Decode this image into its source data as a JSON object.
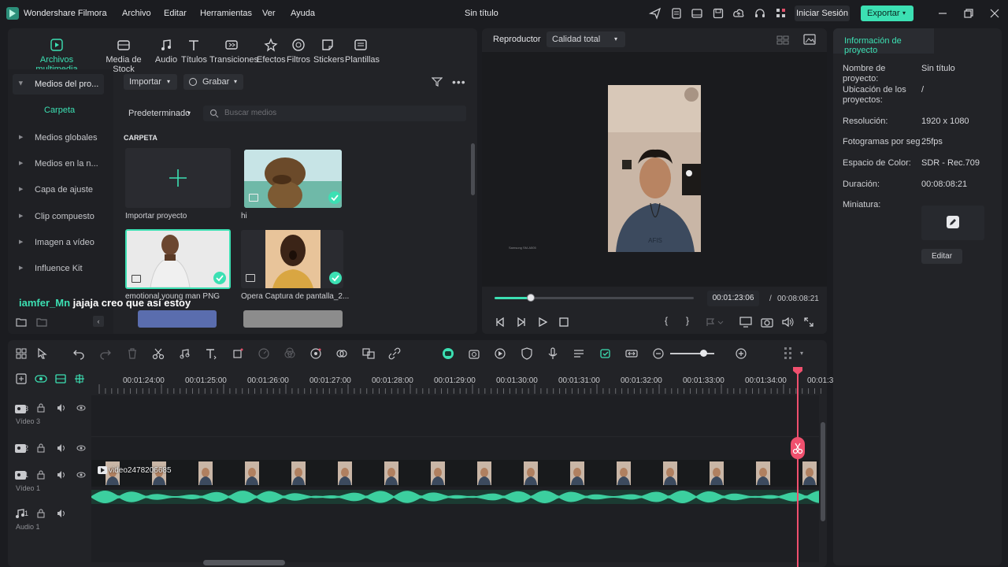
{
  "app": {
    "title": "Wondershare Filmora",
    "document_title": "Sin título",
    "menu": [
      "Archivo",
      "Editar",
      "Herramientas",
      "Ver",
      "Ayuda"
    ],
    "login_label": "Iniciar Sesión",
    "export_label": "Exportar",
    "accent_color": "#3ce0b3"
  },
  "media_tabs": [
    {
      "label": "Archivos multimedia",
      "icon": "media-icon",
      "active": true
    },
    {
      "label": "Media de Stock",
      "icon": "stock-icon"
    },
    {
      "label": "Audio",
      "icon": "music-note-icon"
    },
    {
      "label": "Títulos",
      "icon": "text-icon"
    },
    {
      "label": "Transiciones",
      "icon": "transition-icon"
    },
    {
      "label": "Efectos",
      "icon": "effects-icon"
    },
    {
      "label": "Filtros",
      "icon": "filter-icon"
    },
    {
      "label": "Stickers",
      "icon": "sticker-icon"
    },
    {
      "label": "Plantillas",
      "icon": "template-icon"
    }
  ],
  "sidebar": {
    "header": "Medios del pro...",
    "folder": "Carpeta",
    "items": [
      "Medios globales",
      "Medios en la n...",
      "Capa de ajuste",
      "Clip compuesto",
      "Imagen a vídeo",
      "Influence Kit"
    ]
  },
  "media_toolbar": {
    "import_label": "Importar",
    "record_label": "Grabar",
    "sort_label": "Predeterminado",
    "search_placeholder": "Buscar medios",
    "folder_heading": "CARPETA"
  },
  "media_items": [
    {
      "label": "Importar proyecto"
    },
    {
      "label": "hi"
    },
    {
      "label": "emotional young man PNG"
    },
    {
      "label": "Opera Captura de pantalla_2..."
    }
  ],
  "overlay_caption": {
    "user": "iamfer_Mn",
    "text": "jajaja creo que así estoy"
  },
  "player": {
    "label": "Reproductor",
    "quality": "Calidad total",
    "current_time": "00:01:23:06",
    "separator": "/",
    "total_time": "00:08:08:21",
    "progress": 0.18,
    "watermark": "Samsung SM-A505"
  },
  "project_info": {
    "tab": "Información de proyecto",
    "fields": [
      {
        "label": "Nombre de proyecto:",
        "value": "Sin título"
      },
      {
        "label": "Ubicación de los proyectos:",
        "value": "/"
      },
      {
        "label": "Resolución:",
        "value": "1920 x 1080"
      },
      {
        "label": "Fotogramas por seg",
        "value": "25fps"
      },
      {
        "label": "Espacio de Color:",
        "value": "SDR - Rec.709"
      },
      {
        "label": "Duración:",
        "value": "00:08:08:21"
      },
      {
        "label": "Miniatura:",
        "value": ""
      }
    ],
    "edit_label": "Editar"
  },
  "timeline": {
    "ruler": [
      "00:01:24:00",
      "00:01:25:00",
      "00:01:26:00",
      "00:01:27:00",
      "00:01:28:00",
      "00:01:29:00",
      "00:01:30:00",
      "00:01:31:00",
      "00:01:32:00",
      "00:01:33:00",
      "00:01:34:00",
      "00:01:3"
    ],
    "tracks": [
      {
        "num": "3",
        "name": "Vídeo 3"
      },
      {
        "num": "2",
        "name": ""
      },
      {
        "num": "1",
        "name": "Vídeo 1"
      },
      {
        "num": "1",
        "name": "Audio 1"
      }
    ],
    "clip_name": "video2478206685",
    "playhead_color": "#f0506e",
    "zoom_level": 0.75
  }
}
